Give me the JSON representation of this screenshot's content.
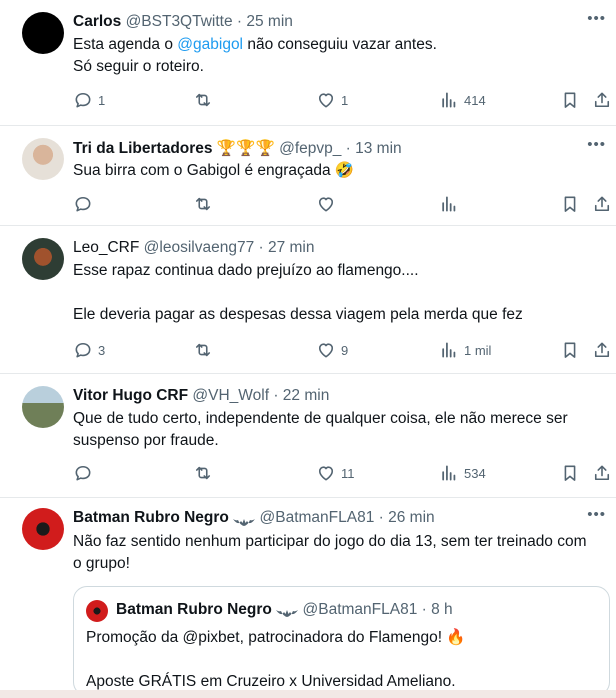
{
  "tweets": [
    {
      "name": "Carlos",
      "handle": "@BST3QTwitte",
      "time": "· 25 min",
      "text_pre": "Esta agenda o ",
      "text_link": "@gabigol",
      "text_post": " não conseguiu vazar antes.",
      "text2": "Só seguir o roteiro.",
      "replies": "1",
      "likes": "1",
      "views": "414"
    },
    {
      "name": "Tri da Libertadores",
      "badges": "🏆🏆🏆",
      "handle": "@fepvp_",
      "time": "· 13 min",
      "text1": "Sua birra com o Gabigol é engraçada 🤣"
    },
    {
      "name": "Leo_CRF",
      "handle": "@leosilvaeng77",
      "time": "· 27 min",
      "text1": "Esse rapaz continua dado prejuízo ao flamengo....",
      "text2": "Ele deveria pagar as despesas dessa viagem pela merda que fez",
      "replies": "3",
      "likes": "9",
      "views": "1 mil"
    },
    {
      "name": "Vitor Hugo CRF",
      "handle": "@VH_Wolf",
      "time": "· 22 min",
      "text1": "Que de tudo certo, independente de qualquer coisa, ele não merece ser",
      "text2": "suspenso por fraude.",
      "likes": "11",
      "views": "534"
    },
    {
      "name": "Batman Rubro Negro",
      "handle": "@BatmanFLA81",
      "time": "· 26 min",
      "text1": "Não faz sentido nenhum participar do jogo do dia 13, sem ter treinado com",
      "text2": "o grupo!",
      "quote": {
        "name": "Batman Rubro Negro",
        "handle": "@BatmanFLA81",
        "time": "· 8 h",
        "text1": "Promoção da @pixbet, patrocinadora do Flamengo! 🔥",
        "text2": "Aposte GRÁTIS em Cruzeiro x Universidad Ameliano."
      }
    }
  ],
  "colors": {
    "link": "#1d9bf0",
    "muted": "#536471",
    "border": "#e6e9eb"
  }
}
